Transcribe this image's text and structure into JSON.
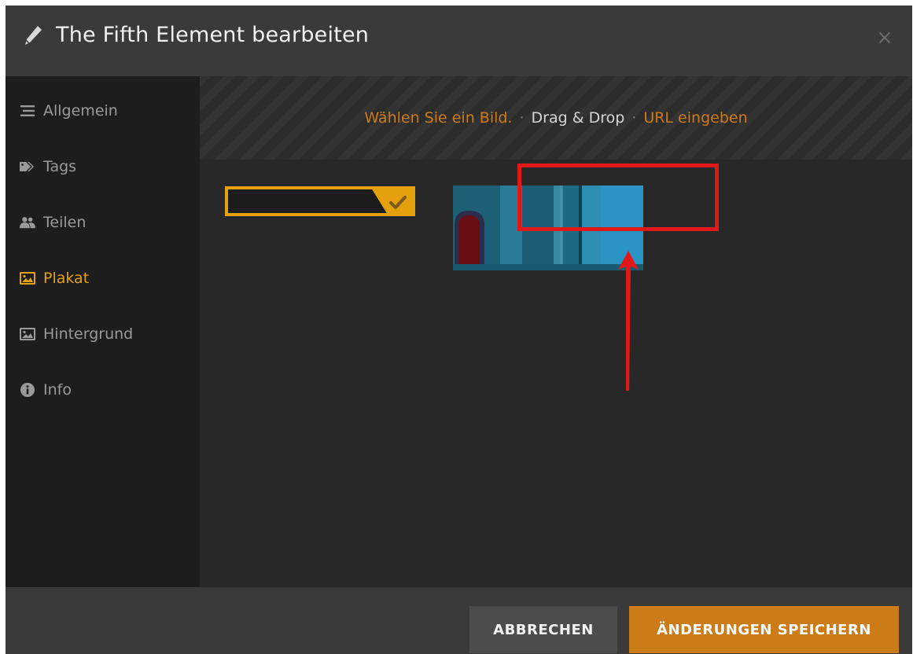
{
  "dialog": {
    "title": "The Fifth Element bearbeiten",
    "close_label": "×"
  },
  "sidebar": {
    "items": [
      {
        "label": "Allgemein",
        "icon": "list-icon",
        "active": false
      },
      {
        "label": "Tags",
        "icon": "tags-icon",
        "active": false
      },
      {
        "label": "Teilen",
        "icon": "users-icon",
        "active": false
      },
      {
        "label": "Plakat",
        "icon": "image-icon",
        "active": true
      },
      {
        "label": "Hintergrund",
        "icon": "image-icon",
        "active": false
      },
      {
        "label": "Info",
        "icon": "info-icon",
        "active": false
      }
    ]
  },
  "upload": {
    "choose_label": "Wählen Sie ein Bild.",
    "separator": "·",
    "drag_label": "Drag & Drop",
    "url_label": "URL eingeben"
  },
  "footer": {
    "cancel_label": "ABBRECHEN",
    "save_label": "ÄNDERUNGEN SPEICHERN"
  },
  "colors": {
    "accent": "#e5a00d",
    "link": "#cc7b19",
    "save_button": "#cc7b19",
    "annotation": "#e01818",
    "header_bg": "#3a3a3a",
    "sidebar_bg": "#1d1d1d",
    "content_bg": "#282828"
  }
}
